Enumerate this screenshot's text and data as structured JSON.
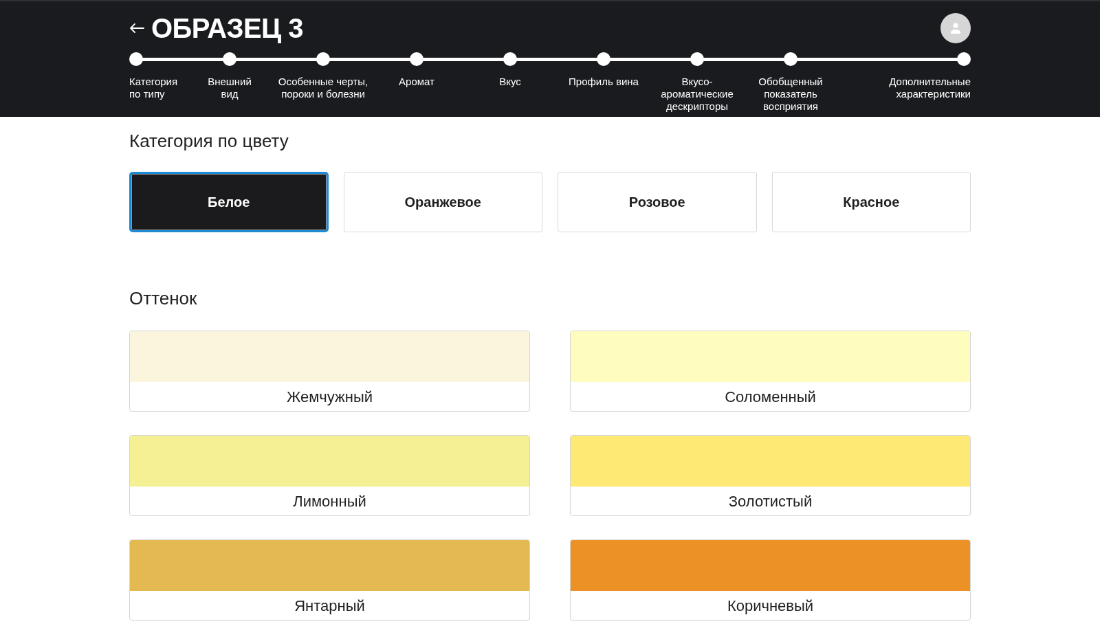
{
  "header": {
    "title": "ОБРАЗЕЦ 3"
  },
  "steps": [
    {
      "label": "Категория\nпо типу"
    },
    {
      "label": "Внешний\nвид"
    },
    {
      "label": "Особенные черты,\nпороки и болезни"
    },
    {
      "label": "Аромат"
    },
    {
      "label": "Вкус"
    },
    {
      "label": "Профиль вина"
    },
    {
      "label": "Вкусо-ароматические\nдескрипторы"
    },
    {
      "label": "Обобщенный\nпоказатель\nвосприятия"
    },
    {
      "label": "Дополнительные\nхарактеристики"
    }
  ],
  "color_category": {
    "title": "Категория по цвету",
    "options": [
      {
        "label": "Белое",
        "selected": true
      },
      {
        "label": "Оранжевое",
        "selected": false
      },
      {
        "label": "Розовое",
        "selected": false
      },
      {
        "label": "Красное",
        "selected": false
      }
    ]
  },
  "shade": {
    "title": "Оттенок",
    "options": [
      {
        "label": "Жемчужный",
        "color": "#faf5dc",
        "selected": false
      },
      {
        "label": "Соломенный",
        "color": "#fffdbd",
        "selected": false
      },
      {
        "label": "Лимонный",
        "color": "#f5f094",
        "selected": false
      },
      {
        "label": "Золотистый",
        "color": "#ffe975",
        "selected": false
      },
      {
        "label": "Янтарный",
        "color": "#e5b952",
        "selected": false
      },
      {
        "label": "Коричневый",
        "color": "#ec9126",
        "selected": false
      }
    ]
  }
}
